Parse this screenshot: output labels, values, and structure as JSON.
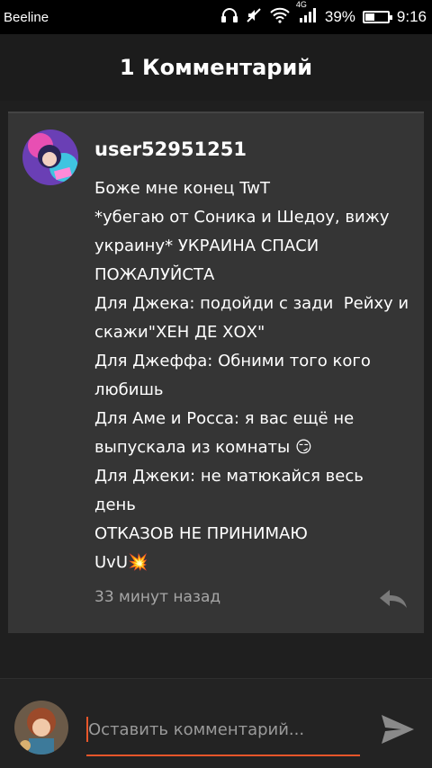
{
  "status_bar": {
    "carrier": "Beeline",
    "network_label": "4G",
    "battery_percent": "39%",
    "battery_level": 0.39,
    "time": "9:16"
  },
  "header": {
    "title": "1 Комментарий"
  },
  "comment": {
    "username": "user52951251",
    "text": "Боже мне конец TwT\n*убегаю от Соника и Шедоу, вижу украину* УКРАИНА СПАСИ ПОЖАЛУЙСТА\nДля Джека: подойди с зади  Рейху и скажи\"ХЕН ДЕ ХОХ\"\nДля Джеффа: Обними того кого любишь\nДля Аме и Росса: я вас ещё не выпускала из комнаты 😏\nДля Джеки: не матюкайся весь день\nОТКАЗОВ НЕ ПРИНИМАЮ\nUvU💥",
    "timestamp": "33 минут назад"
  },
  "composer": {
    "placeholder": "Оставить комментарий..."
  },
  "colors": {
    "accent": "#e8562a",
    "card_bg": "#353535",
    "page_bg": "#1f1f1f"
  }
}
